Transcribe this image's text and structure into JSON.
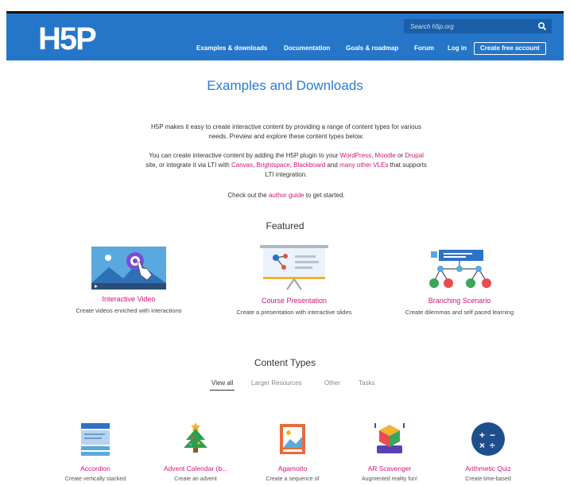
{
  "header": {
    "logo_text": "H5P",
    "search_placeholder": "Search h5p.org",
    "nav": [
      {
        "label": "Examples & downloads"
      },
      {
        "label": "Documentation"
      },
      {
        "label": "Goals & roadmap"
      },
      {
        "label": "Forum"
      },
      {
        "label": "Log in"
      },
      {
        "label": "Create free account"
      }
    ]
  },
  "page_title": "Examples and Downloads",
  "intro": {
    "p1": "H5P makes it easy to create interactive content by providing a range of content types for various needs. Preview and explore these content types below.",
    "p2": {
      "t1": "You can create interactive content by adding the H5P plugin to your ",
      "l1": "WordPress",
      "t2": ", ",
      "l2": "Moodle",
      "t3": " or ",
      "l3": "Drupal",
      "t4": " site, or integrate it via LTI with ",
      "l4": "Canvas",
      "t5": ", ",
      "l5": "Brightspace",
      "t6": ", ",
      "l6": "Blackboard",
      "t7": " and ",
      "l7": "many other VLEs",
      "t8": " that supports LTI integration."
    },
    "p3": {
      "t1": "Check out the ",
      "l1": "author guide",
      "t2": " to get started."
    }
  },
  "featured": {
    "heading": "Featured",
    "items": [
      {
        "name": "Interactive Video",
        "desc": "Create videos enriched with interactions"
      },
      {
        "name": "Course Presentation",
        "desc": "Create a presentation with interactive slides"
      },
      {
        "name": "Branching Scenario",
        "desc": "Create dilemmas and self paced learning"
      }
    ]
  },
  "content_types": {
    "heading": "Content Types",
    "tabs": [
      {
        "label": "View all",
        "active": true
      },
      {
        "label": "Larger Resources",
        "active": false
      },
      {
        "label": "Other",
        "active": false
      },
      {
        "label": "Tasks",
        "active": false
      }
    ],
    "items": [
      {
        "name": "Accordion",
        "desc": "Create vertically stacked",
        "icon": "accordion-icon"
      },
      {
        "name": "Advent Calendar (b...",
        "desc": "Create an advent",
        "icon": "christmas-tree-icon"
      },
      {
        "name": "Agamotto",
        "desc": "Create a sequence of",
        "icon": "image-sequence-icon"
      },
      {
        "name": "AR Scavenger",
        "desc": "Augmented reality fun!",
        "icon": "ar-cube-icon"
      },
      {
        "name": "Arithmetic Quiz",
        "desc": "Create time-based",
        "icon": "arithmetic-icon"
      }
    ]
  },
  "colors": {
    "brand_blue": "#2576c9",
    "link_magenta": "#d4147a",
    "title_blue": "#2a7ad5"
  }
}
